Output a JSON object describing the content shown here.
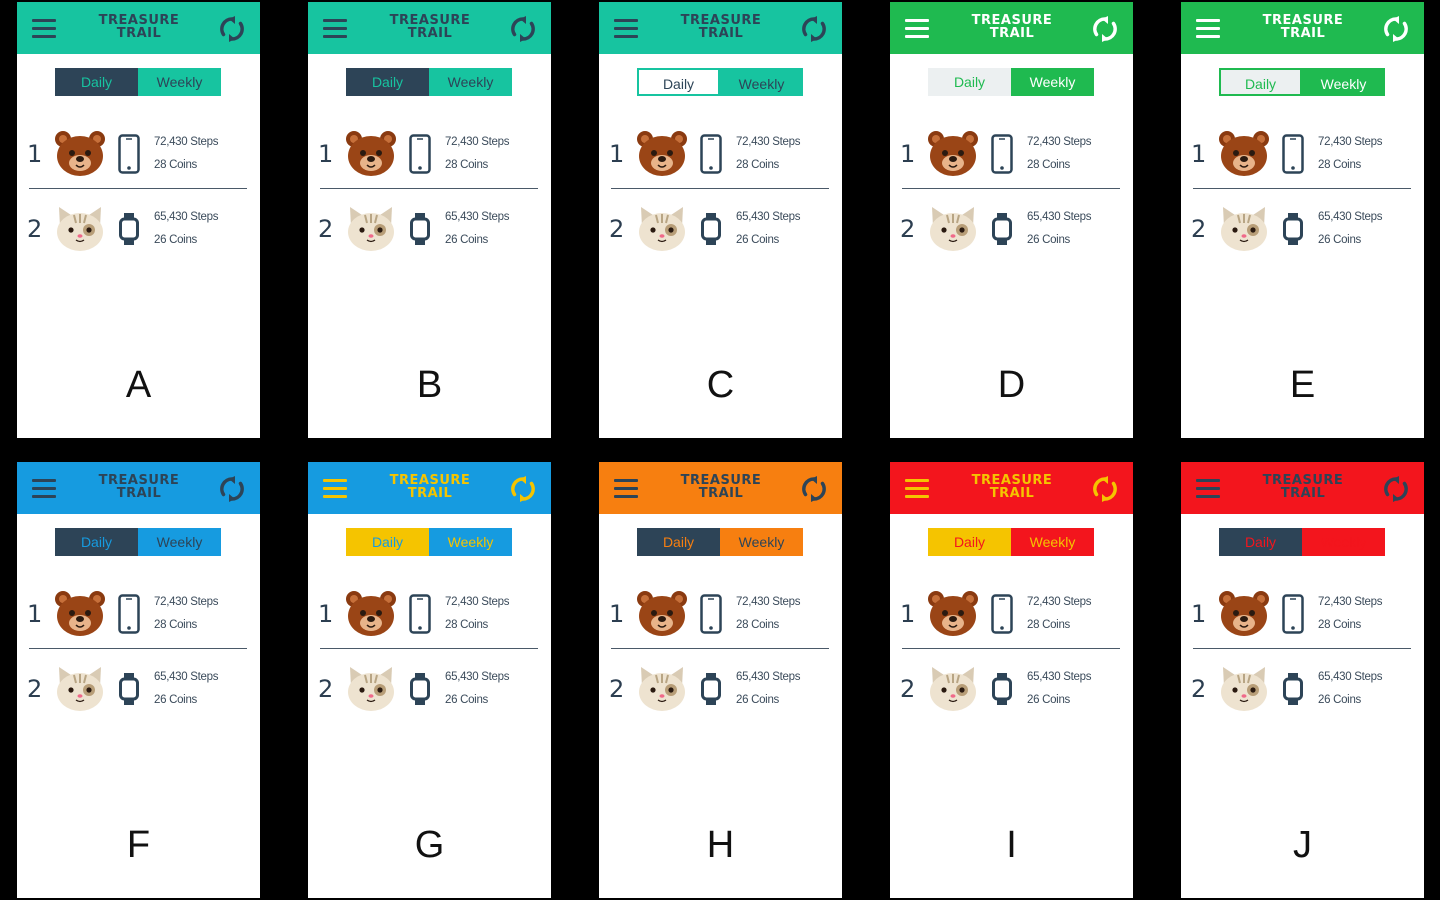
{
  "app": {
    "title_line1": "TREASURE",
    "title_line2": "TRAIL"
  },
  "toggle": {
    "daily": "Daily",
    "weekly": "Weekly"
  },
  "leaderboard": [
    {
      "rank": "1",
      "avatar": "bear-avatar",
      "device": "phone-icon",
      "steps": "72,430 Steps",
      "coins": "28 Coins"
    },
    {
      "rank": "2",
      "avatar": "cat-avatar",
      "device": "smartwatch-icon",
      "steps": "65,430 Steps",
      "coins": "26 Coins"
    }
  ],
  "colors": {
    "dark_navy": "#2d4457",
    "teal": "#17c4a0",
    "green": "#1fba50",
    "blue": "#169be0",
    "yellow": "#f5c400",
    "orange": "#f77f10",
    "red": "#f3151d",
    "light_gray": "#ecf0f1"
  },
  "variants": [
    {
      "label": "A",
      "header": "#17c4a0",
      "title_color": "#2d4457",
      "icon_color": "#2d4457",
      "daily_bg": "#2d4457",
      "daily_text": "#17c4a0",
      "daily_border": "none",
      "weekly_bg": "#17c4a0",
      "weekly_text": "#2d4457"
    },
    {
      "label": "B",
      "header": "#17c4a0",
      "title_color": "#2d4457",
      "icon_color": "#2d4457",
      "daily_bg": "#2d4457",
      "daily_text": "#17c4a0",
      "daily_border": "none",
      "weekly_bg": "#17c4a0",
      "weekly_text": "#2d4457"
    },
    {
      "label": "C",
      "header": "#17c4a0",
      "title_color": "#2d4457",
      "icon_color": "#2d4457",
      "daily_bg": "#ffffff",
      "daily_text": "#2d4457",
      "daily_border": "#17c4a0",
      "weekly_bg": "#17c4a0",
      "weekly_text": "#2d4457"
    },
    {
      "label": "D",
      "header": "#1fba50",
      "title_color": "#ffffff",
      "icon_color": "#ffffff",
      "daily_bg": "#ecf0f1",
      "daily_text": "#1fba50",
      "daily_border": "none",
      "weekly_bg": "#1fba50",
      "weekly_text": "#ffffff"
    },
    {
      "label": "E",
      "header": "#1fba50",
      "title_color": "#ffffff",
      "icon_color": "#ffffff",
      "daily_bg": "#ecf0f1",
      "daily_text": "#1fba50",
      "daily_border": "#1fba50",
      "weekly_bg": "#1fba50",
      "weekly_text": "#ffffff"
    },
    {
      "label": "F",
      "header": "#169be0",
      "title_color": "#2d4457",
      "icon_color": "#2d4457",
      "daily_bg": "#2d4457",
      "daily_text": "#169be0",
      "daily_border": "none",
      "weekly_bg": "#169be0",
      "weekly_text": "#2d4457"
    },
    {
      "label": "G",
      "header": "#169be0",
      "title_color": "#f5c400",
      "icon_color": "#f5c400",
      "daily_bg": "#f5c400",
      "daily_text": "#169be0",
      "daily_border": "none",
      "weekly_bg": "#169be0",
      "weekly_text": "#f5c400"
    },
    {
      "label": "H",
      "header": "#f77f10",
      "title_color": "#2d4457",
      "icon_color": "#2d4457",
      "daily_bg": "#2d4457",
      "daily_text": "#f77f10",
      "daily_border": "none",
      "weekly_bg": "#f77f10",
      "weekly_text": "#2d4457"
    },
    {
      "label": "I",
      "header": "#f3151d",
      "title_color": "#f5c400",
      "icon_color": "#f5c400",
      "daily_bg": "#f5c400",
      "daily_text": "#f3151d",
      "daily_border": "none",
      "weekly_bg": "#f3151d",
      "weekly_text": "#f5c400"
    },
    {
      "label": "J",
      "header": "#f3151d",
      "title_color": "#2d4457",
      "icon_color": "#2d4457",
      "daily_bg": "#2d4457",
      "daily_text": "#f3151d",
      "daily_border": "none",
      "weekly_bg": "#f3151d",
      "weekly_text": "#f3151d"
    }
  ]
}
